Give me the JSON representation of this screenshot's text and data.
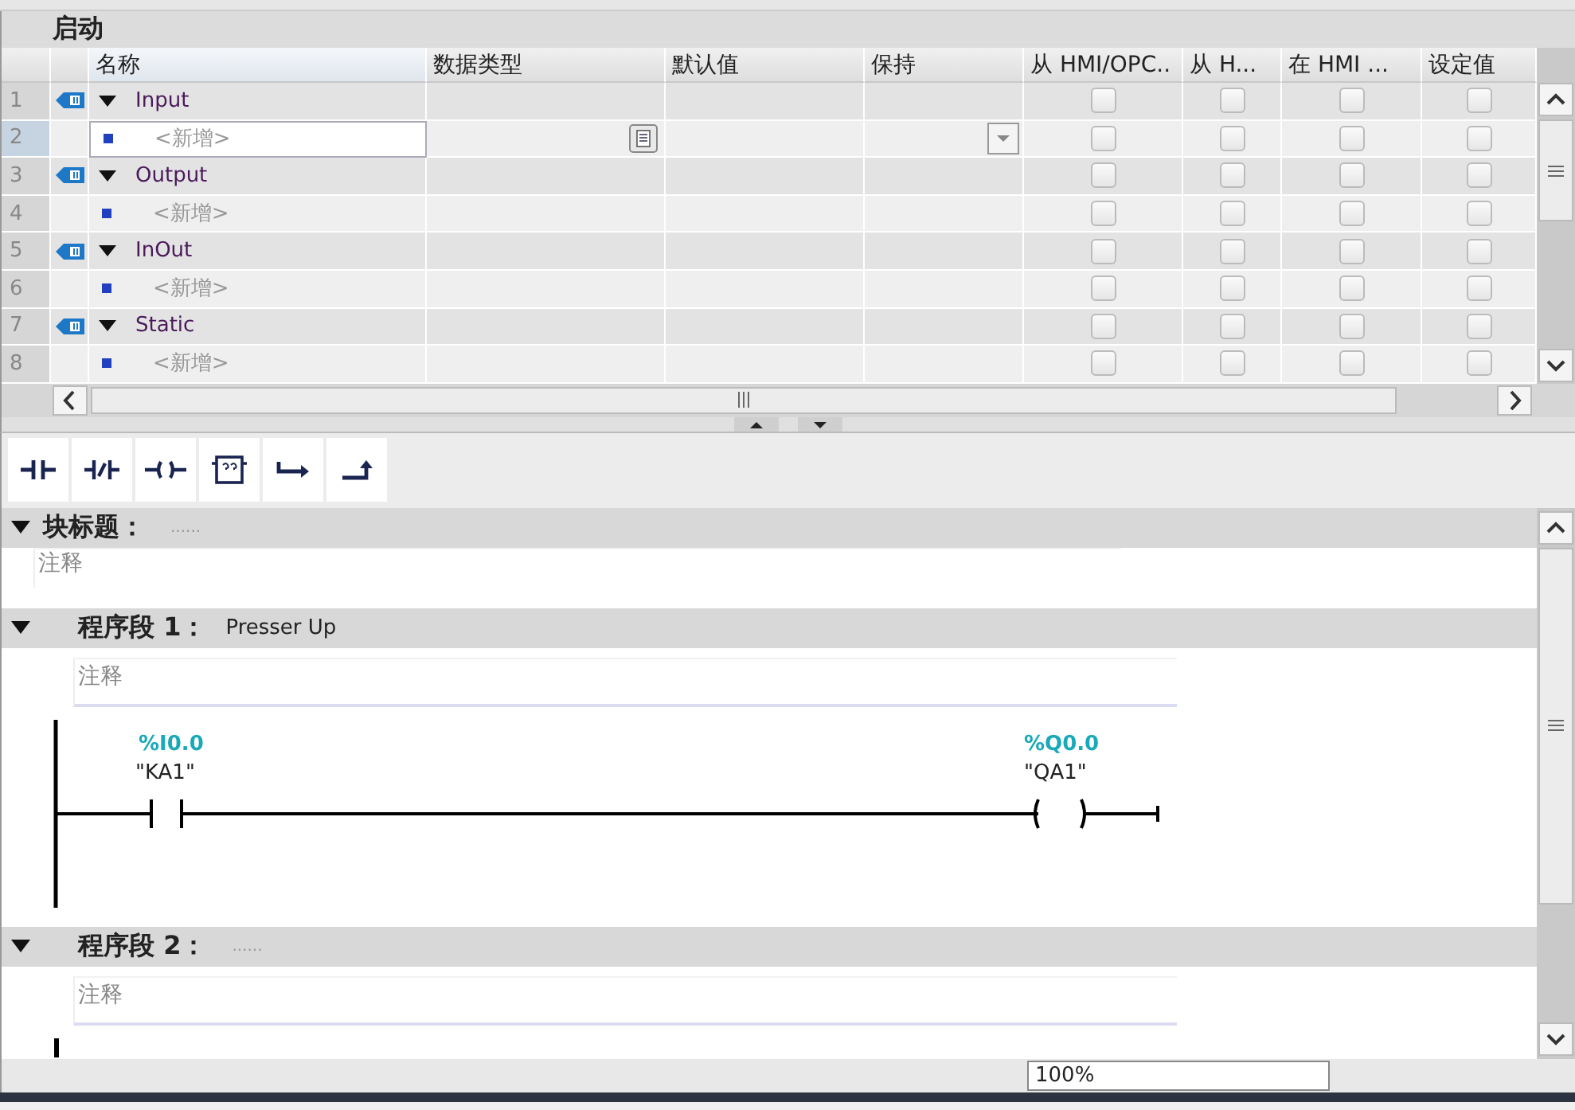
{
  "block_name": "启动",
  "table": {
    "columns": [
      "名称",
      "数据类型",
      "默认值",
      "保持",
      "从 HMI/OPC..",
      "从 H...",
      "在 HMI ...",
      "设定值"
    ],
    "rows": [
      {
        "number": "1",
        "kind": "section",
        "name": "Input",
        "expanded": true,
        "selected": false,
        "checks": [
          false,
          false,
          false,
          false
        ]
      },
      {
        "number": "2",
        "kind": "add",
        "name": "<新增>",
        "selected": true,
        "checks": [
          false,
          false,
          false,
          false
        ]
      },
      {
        "number": "3",
        "kind": "section",
        "name": "Output",
        "expanded": true,
        "selected": false,
        "checks": [
          false,
          false,
          false,
          false
        ]
      },
      {
        "number": "4",
        "kind": "add",
        "name": "<新增>",
        "selected": false,
        "checks": [
          false,
          false,
          false,
          false
        ]
      },
      {
        "number": "5",
        "kind": "section",
        "name": "InOut",
        "expanded": true,
        "selected": false,
        "checks": [
          false,
          false,
          false,
          false
        ]
      },
      {
        "number": "6",
        "kind": "add",
        "name": "<新增>",
        "selected": false,
        "checks": [
          false,
          false,
          false,
          false
        ]
      },
      {
        "number": "7",
        "kind": "section",
        "name": "Static",
        "expanded": true,
        "selected": false,
        "checks": [
          false,
          false,
          false,
          false
        ]
      },
      {
        "number": "8",
        "kind": "add",
        "name": "<新增>",
        "selected": false,
        "checks": [
          false,
          false,
          false,
          false
        ]
      }
    ]
  },
  "toolbar": [
    {
      "kind": "no-contact"
    },
    {
      "kind": "nc-contact"
    },
    {
      "kind": "coil"
    },
    {
      "kind": "box"
    },
    {
      "kind": "branch-open"
    },
    {
      "kind": "branch-close"
    }
  ],
  "block_header": {
    "label": "块标题：",
    "title": "......",
    "comment": "注释",
    "expanded": true
  },
  "networks": [
    {
      "label": "程序段 1：",
      "title": "Presser Up",
      "comment": "注释",
      "expanded": true,
      "contact": {
        "address": "%I0.0",
        "tag": "\"KA1\""
      },
      "coil": {
        "address": "%Q0.0",
        "tag": "\"QA1\""
      }
    },
    {
      "label": "程序段 2：",
      "title": "......",
      "comment": "注释",
      "expanded": true
    }
  ],
  "zoom": "100%"
}
